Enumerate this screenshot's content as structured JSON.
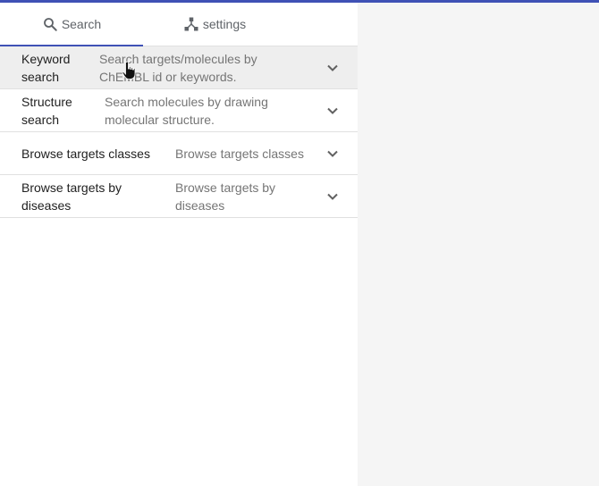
{
  "tabs": [
    {
      "label": "Search",
      "icon": "search-icon",
      "active": true
    },
    {
      "label": "settings",
      "icon": "settings-network-icon",
      "active": false
    }
  ],
  "rows": [
    {
      "title": "Keyword search",
      "description": "Search targets/molecules by ChEMBL id or keywords.",
      "icon": "chevron-down-icon"
    },
    {
      "title": "Structure search",
      "description": "Search molecules by drawing molecular structure.",
      "icon": "chevron-down-icon"
    },
    {
      "title": "Browse targets classes",
      "description": "Browse targets classes",
      "icon": "chevron-down-icon"
    },
    {
      "title": "Browse targets by diseases",
      "description": "Browse targets by diseases",
      "icon": "chevron-down-icon"
    }
  ],
  "colors": {
    "accent": "#3f51b5",
    "muted_text": "#757575",
    "primary_text": "#212121"
  }
}
